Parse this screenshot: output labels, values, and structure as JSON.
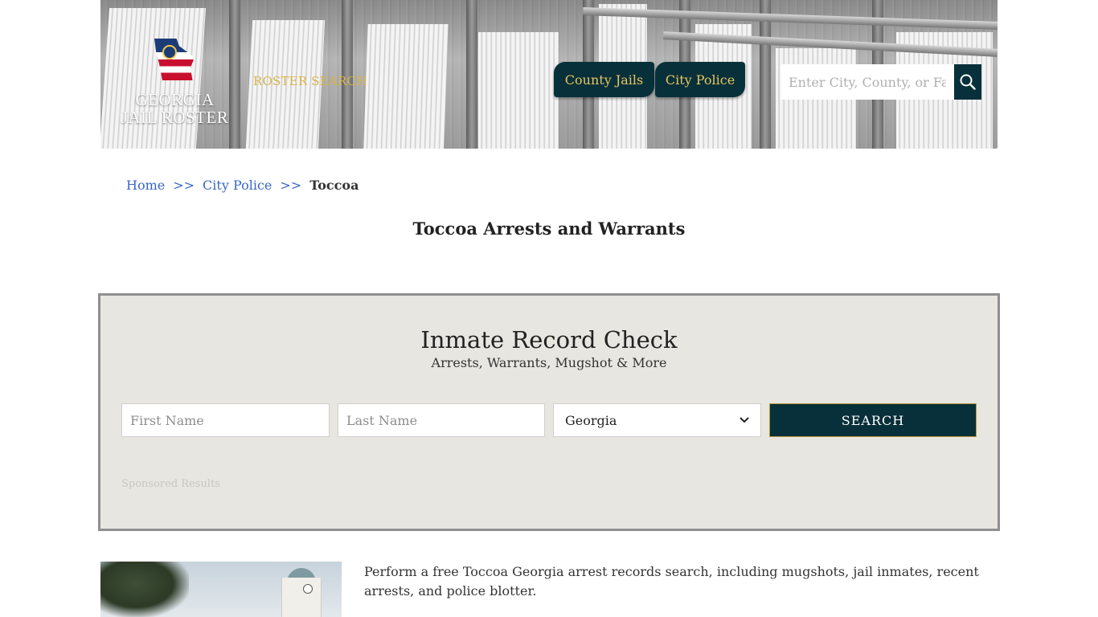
{
  "header": {
    "logo_line1": "GEORGIA",
    "logo_line2": "JAIL ROSTER",
    "roster_search_label": "ROSTER SEARCH",
    "nav": {
      "county_jails": "County Jails",
      "city_police": "City Police"
    },
    "search_placeholder": "Enter City, County, or Facility",
    "search_icon": "magnifier-icon",
    "accent_color": "#08303a",
    "gold_color": "#e6c560"
  },
  "breadcrumb": {
    "home": "Home",
    "separator": ">>",
    "city_police": "City Police",
    "current": "Toccoa"
  },
  "page_title": "Toccoa Arrests and Warrants",
  "record_check": {
    "title": "Inmate Record Check",
    "subtitle": "Arrests, Warrants, Mugshot & More",
    "first_name_placeholder": "First Name",
    "last_name_placeholder": "Last Name",
    "state_selected": "Georgia",
    "search_label": "SEARCH",
    "sponsored": "Sponsored Results"
  },
  "intro_text": "Perform a free Toccoa Georgia arrest records search, including mugshots, jail inmates, recent arrests, and police blotter."
}
